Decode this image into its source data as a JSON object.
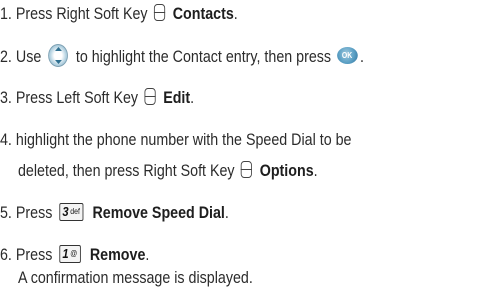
{
  "steps": [
    {
      "num": "1.",
      "pre": "Press Right Soft Key",
      "icon": "soft-key-icon",
      "bold": "Contacts",
      "post": "."
    },
    {
      "num": "2.",
      "pre": "Use",
      "icon": "navigation-key-icon",
      "mid": "to highlight the Contact entry, then press",
      "icon2": "ok-key-icon",
      "ok_label": "OK",
      "post": "."
    },
    {
      "num": "3.",
      "pre": "Press Left Soft Key",
      "icon": "soft-key-icon",
      "bold": "Edit",
      "post": "."
    },
    {
      "num": "4.",
      "line1": "highlight the phone number with the Speed Dial to be",
      "line2_pre": "deleted, then press Right Soft Key",
      "icon": "soft-key-icon",
      "bold": "Options",
      "post": "."
    },
    {
      "num": "5.",
      "pre": "Press",
      "key_main": "3",
      "key_sub": "def",
      "bold": "Remove Speed Dial",
      "post": "."
    },
    {
      "num": "6.",
      "pre": "Press",
      "key_main": "1",
      "key_sub": "@",
      "bold": "Remove",
      "post": ".",
      "note": "A confirmation message is displayed."
    }
  ]
}
